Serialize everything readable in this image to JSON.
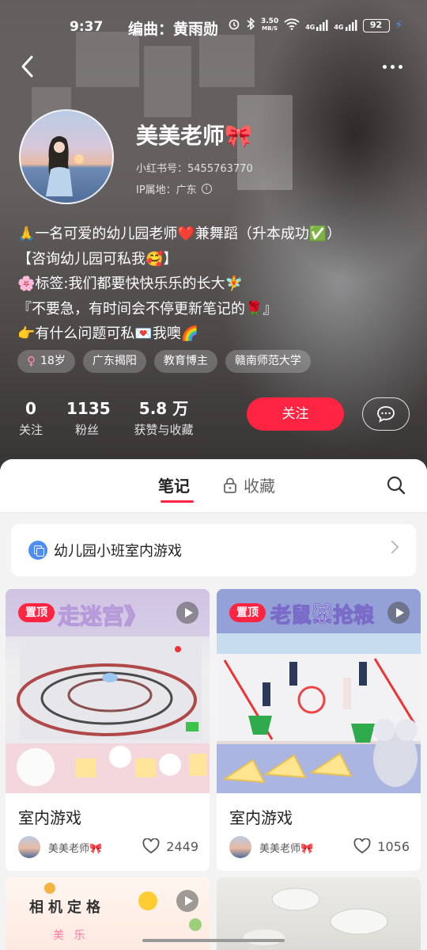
{
  "status_bar": {
    "time": "9:37",
    "composer": "编曲：黄雨勋",
    "speed_value": "3.50",
    "speed_unit": "MB/S",
    "net1": "4G",
    "net2": "4G",
    "battery": "92"
  },
  "profile": {
    "name": "美美老师🎀",
    "red_id": "小红书号：5455763770",
    "ip_location": "IP属地：广东",
    "bio": [
      "🙏一名可爱的幼儿园老师❤️兼舞蹈（升本成功✅）",
      "【咨询幼儿园可私我🥰】",
      "🌸标签:我们都要快快乐乐的长大🧚",
      "『不要急，有时间会不停更新笔记的🌹』",
      "👉有什么问题可私💌我噢🌈"
    ],
    "tags": [
      {
        "label": "18岁",
        "icon": "female-icon"
      },
      {
        "label": "广东揭阳"
      },
      {
        "label": "教育博主"
      },
      {
        "label": "赣南师范大学"
      }
    ],
    "stats": [
      {
        "num": "0",
        "label": "关注"
      },
      {
        "num": "1135",
        "label": "粉丝"
      },
      {
        "num": "5.8 万",
        "label": "获赞与收藏"
      }
    ],
    "follow_label": "关注"
  },
  "tabs": {
    "notes": "笔记",
    "favorites": "收藏"
  },
  "collection": {
    "title": "幼儿园小班室内游戏"
  },
  "notes": [
    {
      "pin": "置顶",
      "title": "室内游戏",
      "author": "美美老师🎀",
      "likes": "2449",
      "cover_text": "走迷宫》"
    },
    {
      "pin": "置顶",
      "title": "室内游戏",
      "author": "美美老师🎀",
      "likes": "1056",
      "cover_text": "老鼠🐭抢粮"
    },
    {
      "cover_text": "相机定格"
    }
  ],
  "colors": {
    "accent": "#ff2442",
    "collection_icon": "#4f8cf4"
  }
}
